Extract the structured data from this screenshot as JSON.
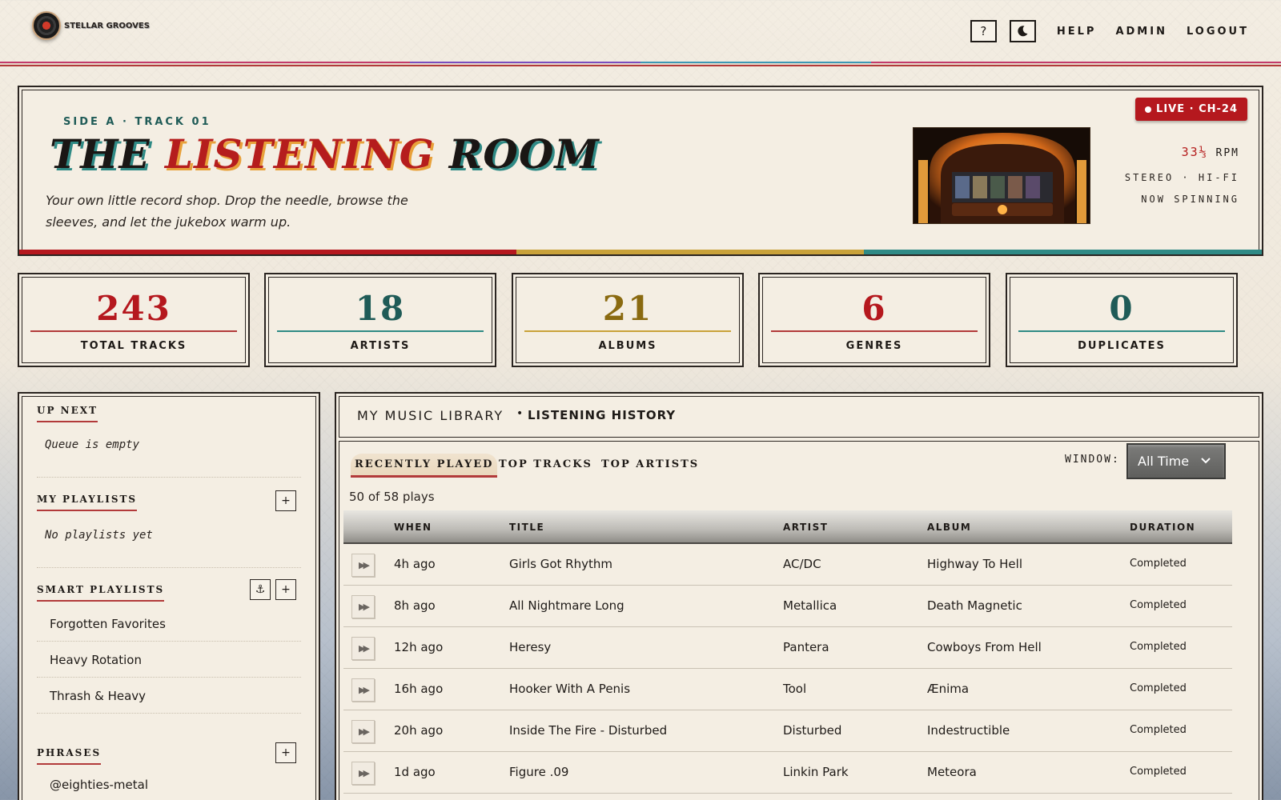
{
  "app": {
    "name": "STELLAR GROOVES"
  },
  "nav": {
    "help_icon": "?",
    "theme_icon": "moon-icon",
    "links": [
      "HELP",
      "ADMIN",
      "LOGOUT"
    ]
  },
  "hero": {
    "eyebrow": "SIDE A · TRACK 01",
    "title_part1": "THE",
    "title_part2": "LISTENING",
    "title_part3": "ROOM",
    "subtitle": "Your own little record shop. Drop the needle, browse the sleeves, and let the jukebox warm up.",
    "live_badge": "LIVE · CH-24",
    "rpm_value": "33⅓",
    "rpm_unit": "RPM",
    "spec_line1": "STEREO · HI-FI",
    "spec_line2": "NOW SPINNING",
    "strip_colors": [
      "#b5181e",
      "#c9a23a",
      "#2f8a85"
    ]
  },
  "stats": [
    {
      "value": "243",
      "label": "TOTAL TRACKS",
      "color": "#b5181e",
      "line": "#b23a3a"
    },
    {
      "value": "18",
      "label": "ARTISTS",
      "color": "#1f5b57",
      "line": "#2f8a85"
    },
    {
      "value": "21",
      "label": "ALBUMS",
      "color": "#8a6a10",
      "line": "#c9a23a"
    },
    {
      "value": "6",
      "label": "GENRES",
      "color": "#b5181e",
      "line": "#b23a3a"
    },
    {
      "value": "0",
      "label": "DUPLICATES",
      "color": "#1f5b57",
      "line": "#2f8a85"
    }
  ],
  "sidebar": {
    "up_next": {
      "heading": "UP NEXT",
      "empty": "Queue is empty"
    },
    "my_playlists": {
      "heading": "MY PLAYLISTS",
      "add_label": "+",
      "empty": "No playlists yet"
    },
    "smart_playlists": {
      "heading": "SMART PLAYLISTS",
      "anchor_label": "⚓",
      "add_label": "+",
      "items": [
        "Forgotten Favorites",
        "Heavy Rotation",
        "Thrash & Heavy"
      ]
    },
    "phrases": {
      "heading": "PHRASES",
      "add_label": "+",
      "items": [
        "@eighties-metal"
      ]
    }
  },
  "main": {
    "breadcrumb": {
      "root": "MY MUSIC LIBRARY",
      "separator": "•",
      "current": "LISTENING HISTORY"
    },
    "tabs": [
      "RECENTLY PLAYED",
      "TOP TRACKS",
      "TOP ARTISTS"
    ],
    "window_label": "WINDOW:",
    "window_value": "All Time",
    "count_text": "50 of 58 plays",
    "columns": [
      "WHEN",
      "TITLE",
      "ARTIST",
      "ALBUM",
      "DURATION"
    ],
    "rows": [
      {
        "when": "4h ago",
        "title": "Girls Got Rhythm",
        "artist": "AC/DC",
        "album": "Highway To Hell",
        "duration": "Completed"
      },
      {
        "when": "8h ago",
        "title": "All Nightmare Long",
        "artist": "Metallica",
        "album": "Death Magnetic",
        "duration": "Completed"
      },
      {
        "when": "12h ago",
        "title": "Heresy",
        "artist": "Pantera",
        "album": "Cowboys From Hell",
        "duration": "Completed"
      },
      {
        "when": "16h ago",
        "title": "Hooker With A Penis",
        "artist": "Tool",
        "album": "Ænima",
        "duration": "Completed"
      },
      {
        "when": "20h ago",
        "title": "Inside The Fire - Disturbed",
        "artist": "Disturbed",
        "album": "Indestructible",
        "duration": "Completed"
      },
      {
        "when": "1d ago",
        "title": "Figure .09",
        "artist": "Linkin Park",
        "album": "Meteora",
        "duration": "Completed"
      }
    ]
  }
}
